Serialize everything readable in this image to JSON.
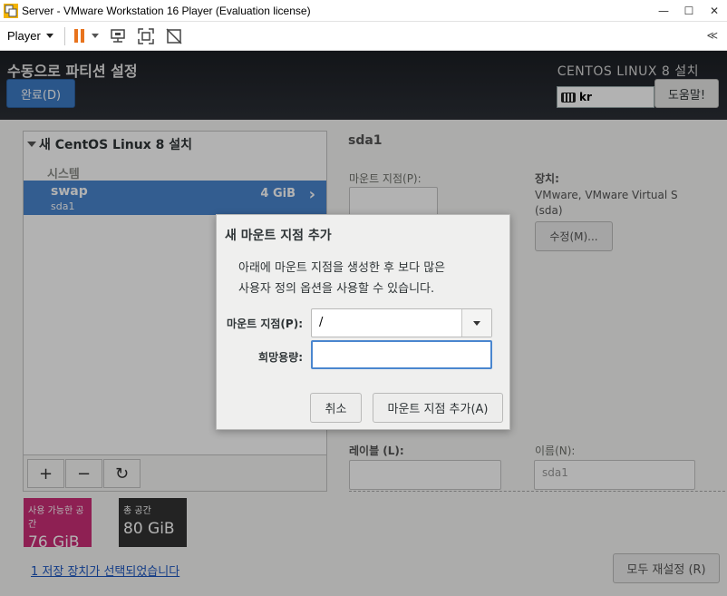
{
  "window": {
    "title": "Server - VMware Workstation 16 Player (Evaluation license)",
    "minimize": "—",
    "maximize": "☐",
    "close": "✕"
  },
  "vmtoolbar": {
    "player_menu": "Player",
    "collapse": "≪"
  },
  "header": {
    "page_title": "수동으로 파티션 설정",
    "done_button": "완료(D)",
    "install_title": "CENTOS LINUX 8 설치",
    "keyboard_layout": "kr",
    "help_button": "도움말!"
  },
  "left_pane": {
    "root_label": "새 CentOS Linux 8 설치",
    "group_label": "시스템",
    "mount_points": [
      {
        "name": "swap",
        "device": "sda1",
        "size": "4 GiB"
      }
    ],
    "add_symbol": "+",
    "remove_symbol": "−",
    "refresh_symbol": "↻"
  },
  "space": {
    "available_label": "사용 가능한 공간",
    "available_value": "76 GiB",
    "total_label": "총 공간",
    "total_value": "80 GiB"
  },
  "storage_link": "1 저장 장치가 선택되었습니다",
  "right_pane": {
    "title": "sda1",
    "mount_point_label": "마운트 지점(P):",
    "device_label": "장치:",
    "device_value": "VMware, VMware Virtual S",
    "device_value2": "(sda)",
    "modify_button": "수정(M)...",
    "label_label": "레이블 (L):",
    "name_label": "이름(N):",
    "name_value": "sda1",
    "reset_button": "모두 재설정 (R)"
  },
  "dialog": {
    "title": "새 마운트 지점 추가",
    "message_line1": "아래에 마운트 지점을 생성한 후 보다 많은",
    "message_line2": "사용자 정의 옵션을 사용할 수 있습니다.",
    "mount_point_label": "마운트 지점(P):",
    "mount_point_value": "/",
    "capacity_label": "희망용량:",
    "capacity_value": "",
    "cancel_button": "취소",
    "add_button": "마운트 지점 추가(A)"
  },
  "colors": {
    "accent": "#4a86cf",
    "available_space": "#cc2e77",
    "total_space": "#333333",
    "pause": "#e8731d"
  }
}
